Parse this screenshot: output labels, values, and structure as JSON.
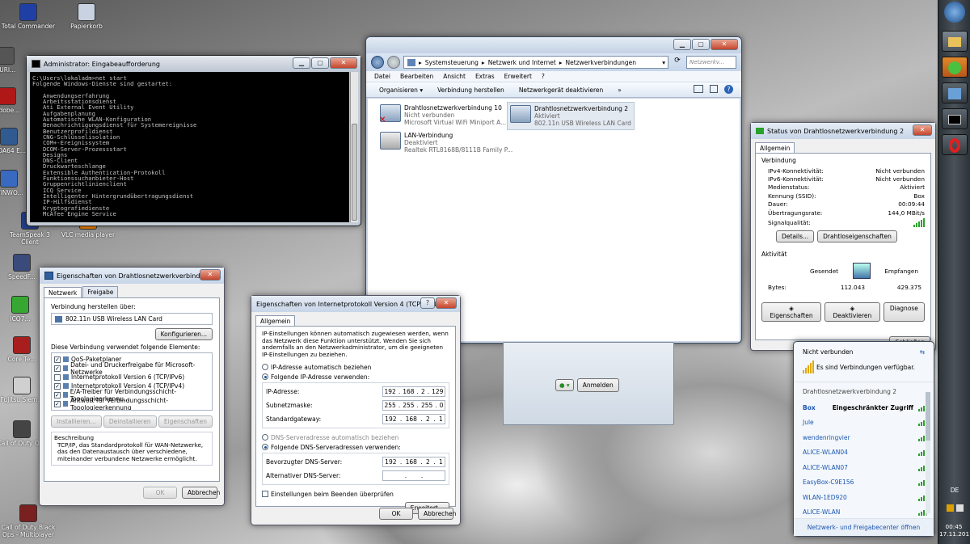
{
  "desktop": {
    "icons": [
      {
        "label": "Total Commander",
        "color": "#1f3fa5"
      },
      {
        "label": "Papierkorb",
        "color": "#c8d2e0"
      },
      {
        "label": "TeamSpeak 3 Client",
        "color": "#24408a"
      },
      {
        "label": "VLC media player",
        "color": "#ee7f00"
      },
      {
        "label": "SpeedF...",
        "color": "#3a4a7a"
      },
      {
        "label": "ICQ7...",
        "color": "#36a832"
      },
      {
        "label": "Core Te...",
        "color": "#a81e1e"
      },
      {
        "label": "Fujitsu Siem...",
        "color": "#d0d0d0"
      },
      {
        "label": "Call of Duty Ops",
        "color": "#444"
      },
      {
        "label": "Call of Duty Black Ops - Multiplayer",
        "color": "#7a2020"
      },
      {
        "label": "Adobe...",
        "color": "#b01818"
      },
      {
        "label": "AIDA64 E...",
        "color": "#305a90"
      },
      {
        "label": "WINWO...",
        "color": "#3a6ac0"
      },
      {
        "label": "PURI...",
        "color": "#555"
      }
    ]
  },
  "cmd": {
    "title": "Administrator: Eingabeaufforderung",
    "lines": [
      "C:\\Users\\lokaladm>net start",
      "Folgende Windows-Dienste sind gestartet:",
      "",
      "   Anwendungserfahrung",
      "   Arbeitsstationsdienst",
      "   Ati External Event Utility",
      "   Aufgabenplanung",
      "   Automatische WLAN-Konfiguration",
      "   Benachrichtigungsdienst für Systemereignisse",
      "   Benutzerprofildienst",
      "   CNG-Schlüsselisolation",
      "   COM+-Ereignissystem",
      "   DCOM-Server-Prozessstart",
      "   Designs",
      "   DNS-Client",
      "   Druckwarteschlange",
      "   Extensible Authentication-Protokoll",
      "   Funktionssuchanbieter-Host",
      "   Gruppenrichtlinienclient",
      "   ICQ Service",
      "   Intelligenter Hintergrundübertragungsdienst",
      "   IP-Hilfsdienst",
      "   Kryptografiedienste",
      "   McAfee Engine Service"
    ]
  },
  "explorer": {
    "breadcrumb": [
      "Systemsteuerung",
      "Netzwerk und Internet",
      "Netzwerkverbindungen"
    ],
    "search_placeholder": "Netzwerkv...",
    "menu": [
      "Datei",
      "Bearbeiten",
      "Ansicht",
      "Extras",
      "Erweitert",
      "?"
    ],
    "toolbar": [
      "Organisieren ▾",
      "Verbindung herstellen",
      "Netzwerkgerät deaktivieren",
      "»"
    ],
    "connections": [
      {
        "name": "Drahtlosnetzwerkverbindung 10",
        "status": "Nicht verbunden",
        "device": "Microsoft Virtual WiFi Miniport A..."
      },
      {
        "name": "Drahtlosnetzwerkverbindung 2",
        "status": "Aktiviert",
        "device": "802.11n USB Wireless LAN Card"
      },
      {
        "name": "LAN-Verbindung",
        "status": "Deaktiviert",
        "device": "Realtek RTL8168B/8111B Family P..."
      }
    ]
  },
  "props": {
    "title": "Eigenschaften von Drahtlosnetzwerkverbindung 2",
    "tabs": [
      "Netzwerk",
      "Freigabe"
    ],
    "connect_label": "Verbindung herstellen über:",
    "adapter": "802.11n USB Wireless LAN Card",
    "configure": "Konfigurieren...",
    "items_label": "Diese Verbindung verwendet folgende Elemente:",
    "items": [
      {
        "label": "QoS-Paketplaner",
        "checked": true
      },
      {
        "label": "Datei- und Druckerfreigabe für Microsoft-Netzwerke",
        "checked": true
      },
      {
        "label": "Internetprotokoll Version 6 (TCP/IPv6)",
        "checked": false
      },
      {
        "label": "Internetprotokoll Version 4 (TCP/IPv4)",
        "checked": true
      },
      {
        "label": "E/A-Treiber für Verbindungsschicht-Topologieerkennu...",
        "checked": true
      },
      {
        "label": "Antwort für Verbindungsschicht-Topologieerkennung",
        "checked": true
      }
    ],
    "install": "Installieren...",
    "uninstall": "Deinstallieren",
    "properties": "Eigenschaften",
    "desc_title": "Beschreibung",
    "desc": "TCP/IP, das Standardprotokoll für WAN-Netzwerke, das den Datenaustausch über verschiedene, miteinander verbundene Netzwerke ermöglicht.",
    "ok": "OK",
    "cancel": "Abbrechen"
  },
  "ipv4": {
    "title": "Eigenschaften von Internetprotokoll Version 4 (TCP/IPv4)",
    "help": "?",
    "tab": "Allgemein",
    "intro": "IP-Einstellungen können automatisch zugewiesen werden, wenn das Netzwerk diese Funktion unterstützt. Wenden Sie sich andernfalls an den Netzwerkadministrator, um die geeigneten IP-Einstellungen zu beziehen.",
    "auto_ip": "IP-Adresse automatisch beziehen",
    "manual_ip": "Folgende IP-Adresse verwenden:",
    "ip_label": "IP-Adresse:",
    "ip": [
      "192",
      "168",
      "2",
      "129"
    ],
    "mask_label": "Subnetzmaske:",
    "mask": [
      "255",
      "255",
      "255",
      "0"
    ],
    "gw_label": "Standardgateway:",
    "gw": [
      "192",
      "168",
      "2",
      "1"
    ],
    "auto_dns": "DNS-Serveradresse automatisch beziehen",
    "manual_dns": "Folgende DNS-Serveradressen verwenden:",
    "dns1_label": "Bevorzugter DNS-Server:",
    "dns1": [
      "192",
      "168",
      "2",
      "1"
    ],
    "dns2_label": "Alternativer DNS-Server:",
    "dns2": [
      "",
      ".",
      ".",
      ""
    ],
    "validate": "Einstellungen beim Beenden überprüfen",
    "advanced": "Erweitert...",
    "ok": "OK",
    "cancel": "Abbrechen"
  },
  "status": {
    "title": "Status von Drahtlosnetzwerkverbindung 2",
    "tab": "Allgemein",
    "conn_head": "Verbindung",
    "rows": [
      {
        "k": "IPv4-Konnektivität:",
        "v": "Nicht verbunden"
      },
      {
        "k": "IPv6-Konnektivität:",
        "v": "Nicht verbunden"
      },
      {
        "k": "Medienstatus:",
        "v": "Aktiviert"
      },
      {
        "k": "Kennung (SSID):",
        "v": "Box"
      },
      {
        "k": "Dauer:",
        "v": "00:09:44"
      },
      {
        "k": "Übertragungsrate:",
        "v": "144,0 MBit/s"
      }
    ],
    "signal_label": "Signalqualität:",
    "details": "Details...",
    "wprops": "Drahtloseigenschaften",
    "activity_head": "Aktivität",
    "sent": "Gesendet",
    "received": "Empfangen",
    "bytes_label": "Bytes:",
    "bytes_sent": "112.043",
    "bytes_recv": "429.375",
    "b_props": "Eigenschaften",
    "b_disable": "Deaktivieren",
    "b_diag": "Diagnose",
    "close": "Schließen"
  },
  "wlan": {
    "not_connected": "Nicht verbunden",
    "available": "Es sind Verbindungen verfügbar.",
    "section": "Drahtlosnetzwerkverbindung 2",
    "connected_ssid": "Box",
    "connected_status": "Eingeschränkter Zugriff",
    "networks": [
      "Jule",
      "wendenringvier",
      "ALICE-WLAN04",
      "ALICE-WLAN07",
      "EasyBox-C9E156",
      "WLAN-1ED920",
      "ALICE-WLAN"
    ],
    "footer": "Netzwerk- und Freigabecenter öffnen"
  },
  "login": {
    "button": "Anmelden"
  },
  "taskbar": {
    "lang": "DE",
    "time": "00:45",
    "date": "17.11.2011"
  }
}
